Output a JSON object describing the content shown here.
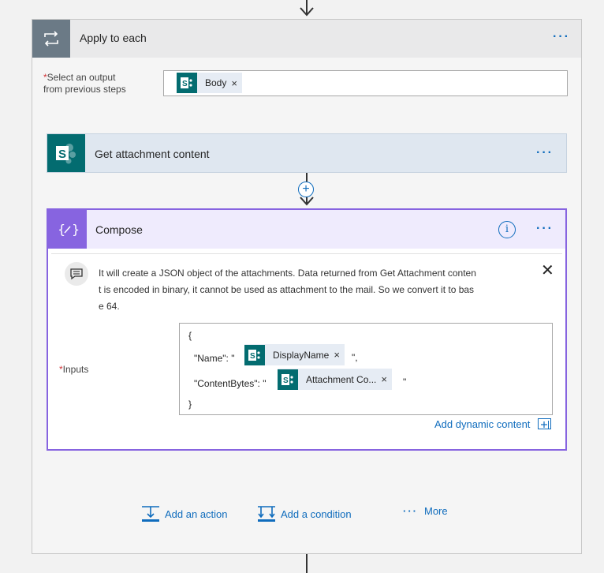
{
  "apply": {
    "title": "Apply to each",
    "menu": "···",
    "select_label_line1": "Select an output",
    "select_label_line2": "from previous steps",
    "required_mark": "*",
    "body_token": {
      "label": "Body",
      "close": "×"
    }
  },
  "get_attachment": {
    "title": "Get attachment content",
    "menu": "···"
  },
  "add_step_icon": "+",
  "compose": {
    "title": "Compose",
    "info": "i",
    "menu": "···",
    "comment": "It will create a JSON object of the attachments. Data returned from Get Attachment content is encoded in binary, it cannot be used as attachment to the mail. So we convert it to base 64.",
    "comment_close": "✕",
    "inputs_label": "Inputs",
    "required_mark": "*",
    "inputs": {
      "open_brace": "{",
      "name_key": "\"Name\": \"",
      "name_token": {
        "label": "DisplayName",
        "close": "×"
      },
      "name_suffix": "\",",
      "content_key": "\"ContentBytes\": \"",
      "content_token": {
        "label": "Attachment Co...",
        "close": "×"
      },
      "content_suffix": "\"",
      "close_brace": "}"
    },
    "add_dynamic": "Add dynamic content"
  },
  "bottom": {
    "add_action": "Add an action",
    "add_condition": "Add a condition",
    "more_dots": "···",
    "more": "More"
  },
  "colors": {
    "accent_blue": "#0f6cbd",
    "sharepoint_teal": "#036c70",
    "compose_purple": "#8764e0",
    "required_red": "#d13438"
  }
}
